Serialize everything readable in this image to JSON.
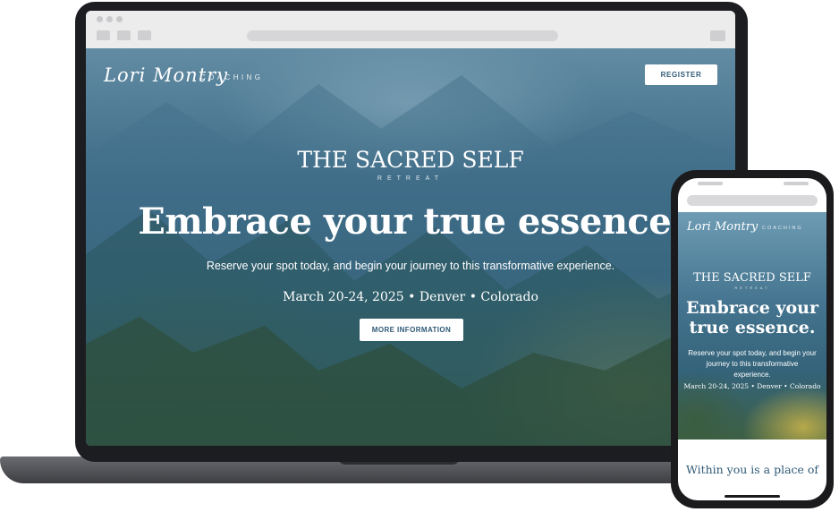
{
  "laptop": {
    "brand": {
      "script": "Lori Montry",
      "tagline": "COACHING"
    },
    "nav": {
      "register_label": "REGISTER"
    },
    "hero": {
      "retreat_title": "THE SACRED SELF",
      "retreat_subtitle": "RETREAT",
      "headline": "Embrace your true essence.",
      "subheadline": "Reserve your spot today, and begin your journey to this transformative experience.",
      "event_details": "March 20-24, 2025 • Denver • Colorado",
      "cta_label": "MORE INFORMATION"
    }
  },
  "phone": {
    "brand": {
      "script": "Lori Montry",
      "tagline": "COACHING"
    },
    "hero": {
      "retreat_title": "THE SACRED SELF",
      "retreat_subtitle": "RETREAT",
      "headline_line1": "Embrace your",
      "headline_line2": "true essence.",
      "body_line1": "Reserve your spot today, and begin your",
      "body_line2": "journey to this transformative experience.",
      "event_details": "March 20-24, 2025 • Denver • Colorado"
    },
    "next_section_heading": "Within you is a place of"
  },
  "colors": {
    "accent": "#2f5a77",
    "device": "#1c1d20"
  }
}
